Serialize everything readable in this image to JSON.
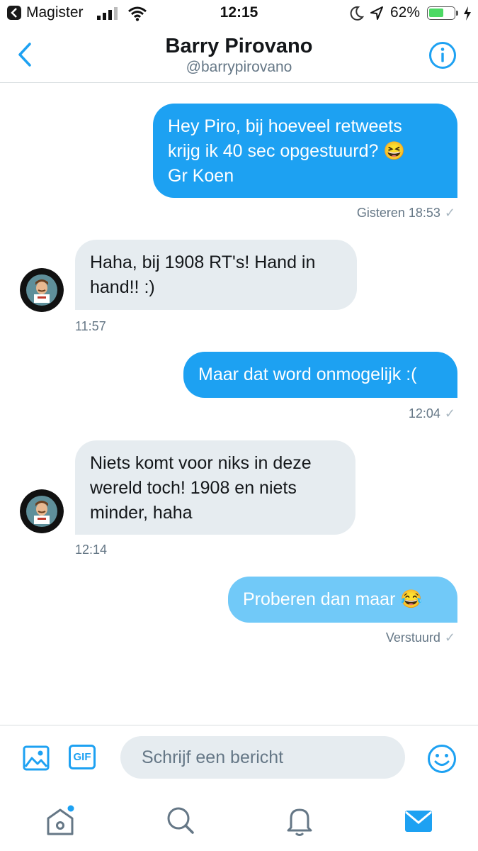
{
  "status_bar": {
    "carrier": "Magister",
    "time": "12:15",
    "battery_percent_label": "62%",
    "battery_level": 0.62
  },
  "header": {
    "name": "Barry Pirovano",
    "handle": "@barrypirovano"
  },
  "messages": [
    {
      "direction": "outgoing",
      "lines": [
        "Hey Piro, bij hoeveel retweets",
        "krijg ik 40 sec opgestuurd? 😆",
        "Gr Koen"
      ],
      "meta": "Gisteren 18:53",
      "check": "✓"
    },
    {
      "direction": "incoming",
      "lines": [
        "Haha, bij 1908 RT's! Hand in",
        "hand!! :)"
      ],
      "meta": "11:57"
    },
    {
      "direction": "outgoing",
      "lines": [
        "Maar dat word onmogelijk :("
      ],
      "meta": "12:04",
      "check": "✓"
    },
    {
      "direction": "incoming",
      "lines": [
        "Niets komt voor niks in deze",
        "wereld toch! 1908 en niets",
        "minder, haha"
      ],
      "meta": "12:14"
    },
    {
      "direction": "outgoing",
      "lines": [
        "Proberen dan maar 😂"
      ],
      "meta": "Verstuurd",
      "check": "✓"
    }
  ],
  "composer": {
    "gif_label": "GIF",
    "placeholder": "Schrijf een bericht"
  },
  "icons": {
    "back": "chevron-left-icon",
    "info": "info-icon",
    "photo": "image-icon",
    "emoji": "smiley-icon",
    "home": "home-icon",
    "search": "search-icon",
    "notifications": "bell-icon",
    "messages": "envelope-icon"
  },
  "colors": {
    "accent": "#1da1f2",
    "pending_bubble": "#71c9f8",
    "incoming_bubble": "#e6ecf0",
    "meta_text": "#657786"
  }
}
